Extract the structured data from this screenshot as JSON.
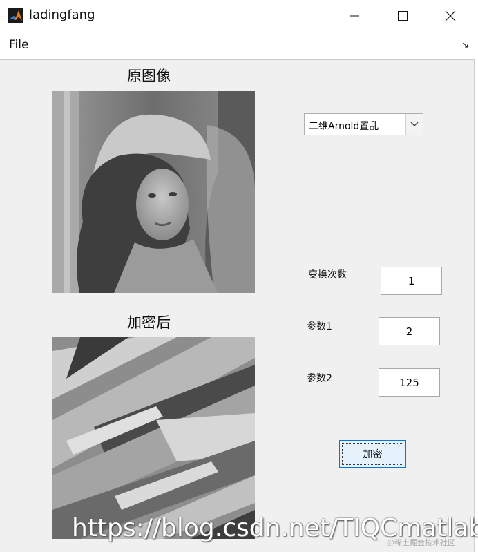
{
  "window": {
    "title": "ladingfang",
    "icon": "matlab-icon",
    "controls": [
      "minimize-icon",
      "maximize-icon",
      "close-icon"
    ]
  },
  "menu": {
    "file_label": "File",
    "dock_icon": "dock-arrow-icon"
  },
  "panels": {
    "original_title": "原图像",
    "encrypted_title": "加密后"
  },
  "method_select": {
    "value": "二维Arnold置乱",
    "arrow_icon": "chevron-down-icon"
  },
  "params": {
    "iterations_label": "变换次数",
    "iterations_value": "1",
    "param1_label": "参数1",
    "param1_value": "2",
    "param2_label": "参数2",
    "param2_value": "125"
  },
  "buttons": {
    "encrypt_label": "加密"
  },
  "watermark": {
    "url": "https://blog.csdn.net/TIQCmatlab",
    "site": "@稀土掘金技术社区"
  },
  "colors": {
    "button_border": "#0078d7",
    "button_fill": "#e5f1fb",
    "background": "#f0f0f0"
  }
}
